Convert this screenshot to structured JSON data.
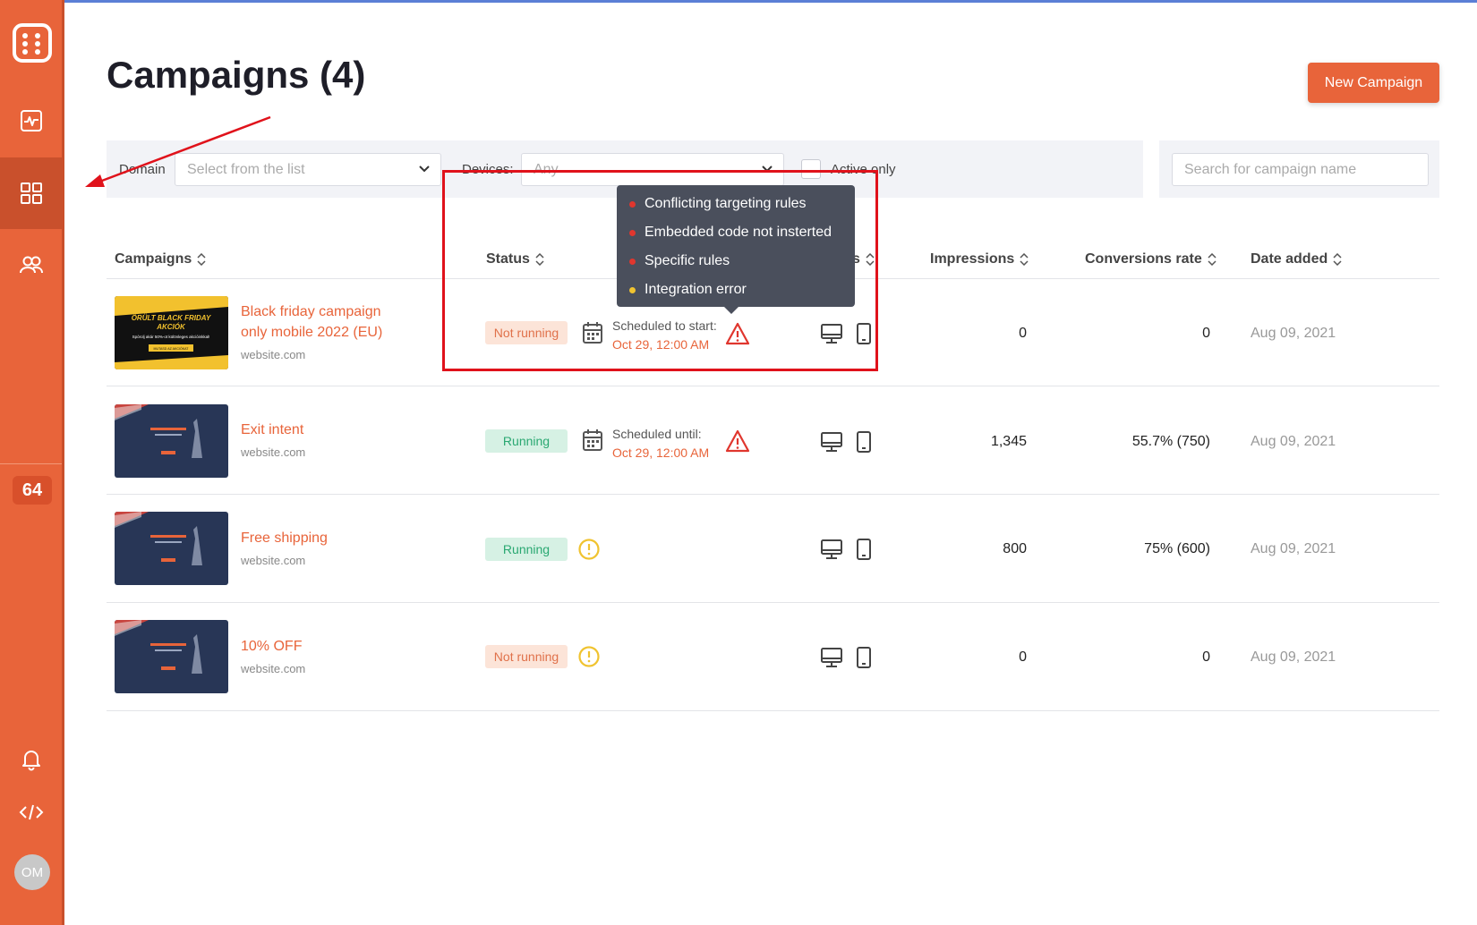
{
  "sidebar": {
    "badge": "64",
    "avatar": "OM"
  },
  "header": {
    "title": "Campaigns (4)",
    "new_button": "New Campaign"
  },
  "filters": {
    "domain_label": "Domain",
    "domain_placeholder": "Select from the list",
    "devices_label": "Devices:",
    "devices_value": "Any",
    "active_only_label": "Active only",
    "search_placeholder": "Search for campaign name"
  },
  "table": {
    "headers": {
      "campaigns": "Campaigns",
      "status": "Status",
      "devices": "s",
      "impressions": "Impressions",
      "conversions": "Conversions rate",
      "date": "Date added"
    },
    "rows": [
      {
        "name_line1": "Black friday campaign",
        "name_line2": "only mobile 2022 (EU)",
        "site": "website.com",
        "status": "Not running",
        "sched_label": "Scheduled to start:",
        "sched_date": "Oct 29, 12:00 AM",
        "impressions": "0",
        "conversions": "0",
        "date": "Aug 09, 2021",
        "thumb_text1": "ŐRÜLT BLACK FRIDAY",
        "thumb_text2": "AKCIÓK",
        "thumb_text3": "Spórolj akár 50%-ot különleges akcióinkkal!",
        "thumb_btn": "MUTASD AZ AKCIÓKAT"
      },
      {
        "name_line1": "Exit intent",
        "site": "website.com",
        "status": "Running",
        "sched_label": "Scheduled until:",
        "sched_date": "Oct 29, 12:00 AM",
        "impressions": "1,345",
        "conversions": "55.7% (750)",
        "date": "Aug 09, 2021"
      },
      {
        "name_line1": "Free shipping",
        "site": "website.com",
        "status": "Running",
        "impressions": "800",
        "conversions": "75% (600)",
        "date": "Aug 09, 2021"
      },
      {
        "name_line1": "10% OFF",
        "site": "website.com",
        "status": "Not running",
        "impressions": "0",
        "conversions": "0",
        "date": "Aug 09, 2021"
      }
    ]
  },
  "tooltip": {
    "items": [
      {
        "label": "Conflicting targeting rules",
        "color": "#e0362e"
      },
      {
        "label": "Embedded code not insterted",
        "color": "#e0362e"
      },
      {
        "label": "Specific rules",
        "color": "#e0362e"
      },
      {
        "label": "Integration error",
        "color": "#f0c330"
      }
    ]
  },
  "colors": {
    "accent": "#e8643a",
    "warning_red": "#e0362e",
    "warning_yellow": "#f0c330",
    "annotation": "#e0121b"
  }
}
